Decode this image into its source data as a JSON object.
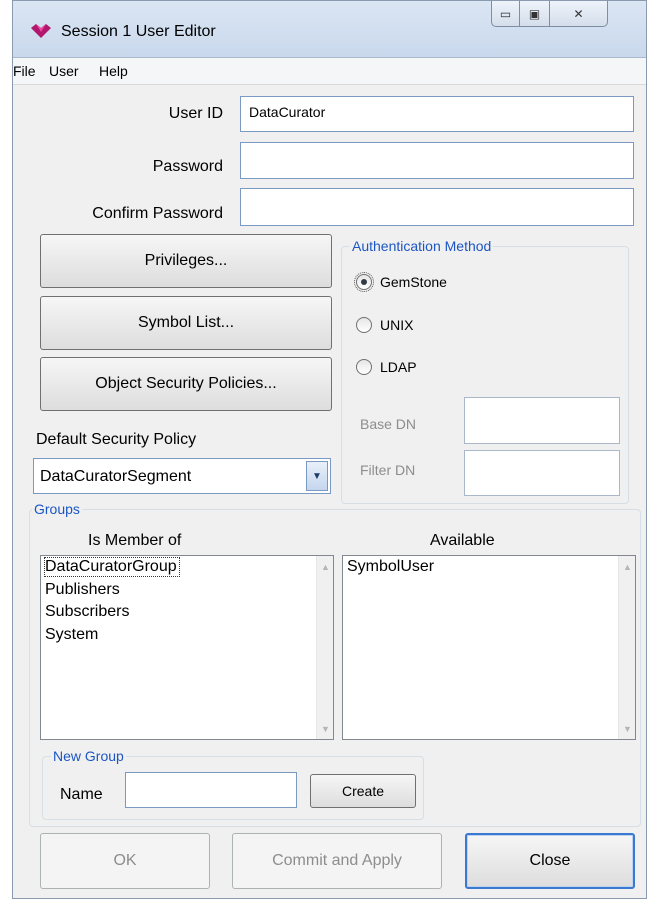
{
  "window": {
    "title": "Session 1 User Editor"
  },
  "window_controls": {
    "minimize": "▭",
    "maximize": "▣",
    "close": "✕"
  },
  "menu": {
    "items": [
      "File",
      "User",
      "Help"
    ]
  },
  "form": {
    "user_id_label": "User ID",
    "user_id_value": "DataCurator",
    "password_label": "Password",
    "password_value": "",
    "confirm_label": "Confirm Password",
    "confirm_value": ""
  },
  "buttons": {
    "privileges": "Privileges...",
    "symbol_list": "Symbol List...",
    "object_security": "Object Security Policies..."
  },
  "auth": {
    "title": "Authentication Method",
    "options": [
      "GemStone",
      "UNIX",
      "LDAP"
    ],
    "selected": "GemStone",
    "base_dn_label": "Base DN",
    "filter_dn_label": "Filter DN"
  },
  "security_policy": {
    "label": "Default Security Policy",
    "value": "DataCuratorSegment"
  },
  "groups": {
    "title": "Groups",
    "member_header": "Is Member of",
    "available_header": "Available",
    "member_of": [
      "DataCuratorGroup",
      "Publishers",
      "Subscribers",
      "System"
    ],
    "available": [
      "SymbolUser"
    ]
  },
  "new_group": {
    "title": "New Group",
    "name_label": "Name",
    "name_value": "",
    "create": "Create"
  },
  "footer": {
    "ok": "OK",
    "commit": "Commit and Apply",
    "close": "Close"
  },
  "colors": {
    "group_title": "#1c55c4",
    "focus_border": "#3b78d0",
    "disabled_text": "#8d8d8d"
  }
}
